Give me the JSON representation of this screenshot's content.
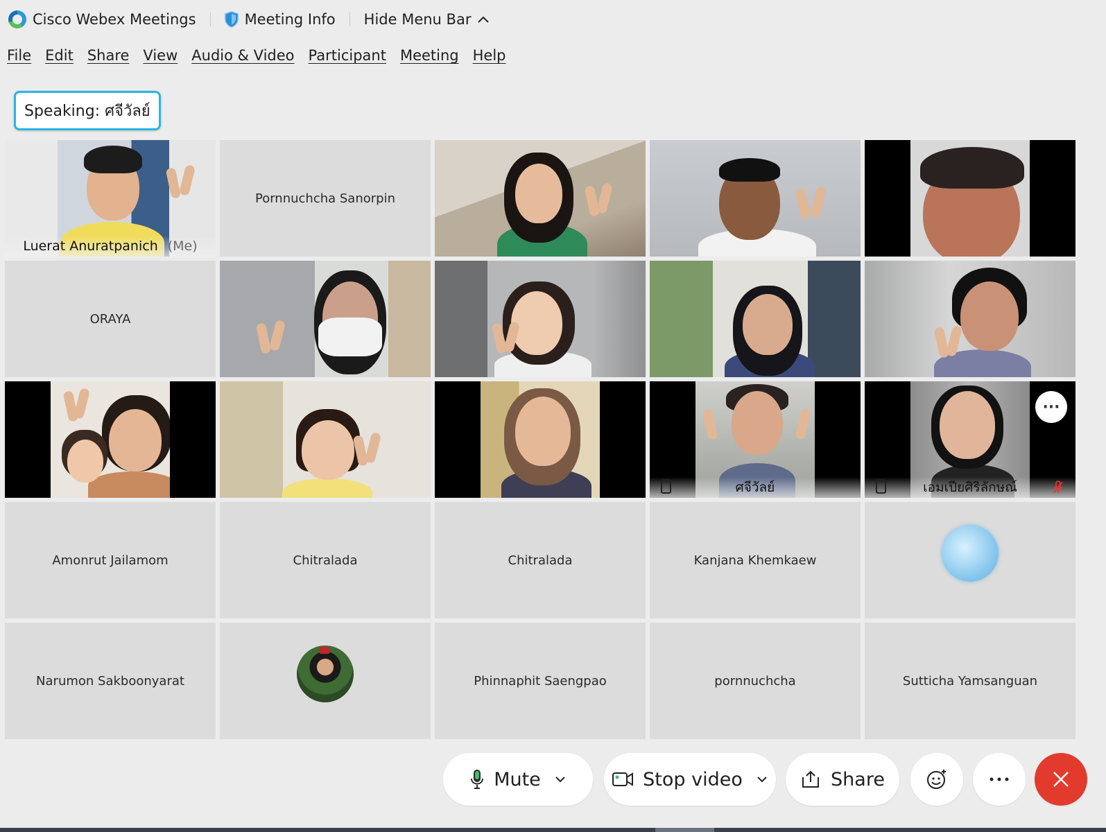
{
  "titlebar": {
    "app_name": "Cisco Webex Meetings",
    "meeting_info": "Meeting Info",
    "hide_menu": "Hide Menu Bar"
  },
  "menu": [
    "File",
    "Edit",
    "Share",
    "View",
    "Audio & Video",
    "Participant",
    "Meeting",
    "Help"
  ],
  "speaking": "Speaking: ศจีวัลย์",
  "tiles": {
    "t1_name": "Luerat Anuratpanich",
    "t1_me": "(Me)",
    "t2_name": "Pornnuchcha Sanorpin",
    "t6_name": "ORAYA",
    "t14_name": "ศจีวัลย์",
    "t15_name": "เอมเปียศิริลักษณ์",
    "t16_name": "Amonrut Jailamom",
    "t17_name": "Chitralada",
    "t18_name": "Chitralada",
    "t19_name": "Kanjana Khemkaew",
    "t21_name": "Narumon Sakboonyarat",
    "t23_name": "Phinnaphit Saengpao",
    "t24_name": "pornnuchcha",
    "t25_name": "Sutticha Yamsanguan"
  },
  "toolbar": {
    "mute": "Mute",
    "stop_video": "Stop video",
    "share": "Share"
  },
  "colors": {
    "accent": "#23b4e6",
    "leave": "#e23b2e",
    "tile_bg": "#dcdcdc"
  }
}
